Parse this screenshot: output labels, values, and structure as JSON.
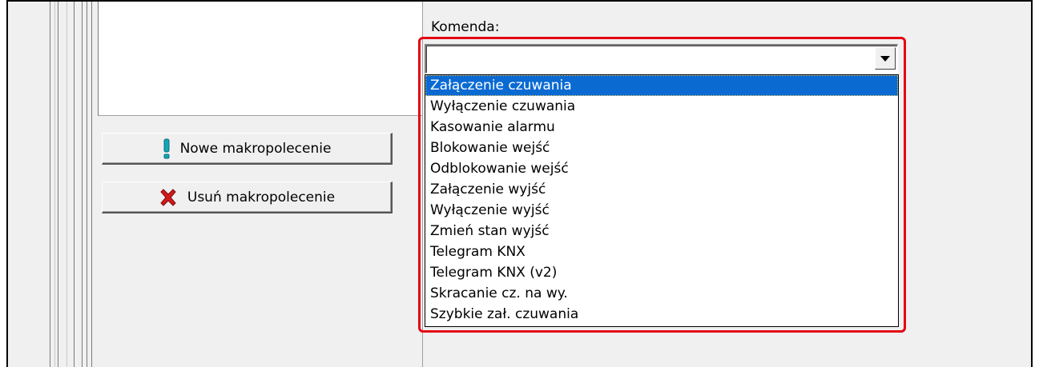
{
  "buttons": {
    "new_macro_label": "Nowe makropolecenie",
    "delete_macro_label": "Usuń makropolecenie"
  },
  "command": {
    "label": "Komenda:",
    "value": "",
    "options": [
      "Załączenie czuwania",
      "Wyłączenie czuwania",
      "Kasowanie alarmu",
      "Blokowanie wejść",
      "Odblokowanie wejść",
      "Załączenie wyjść",
      "Wyłączenie wyjść",
      "Zmień stan wyjść",
      "Telegram KNX",
      "Telegram KNX (v2)",
      "Skracanie cz. na wy.",
      "Szybkie zał. czuwania"
    ],
    "selected_index": 0
  },
  "colors": {
    "highlight_border": "#e30613",
    "selection": "#0a6ad2"
  },
  "icons": {
    "new_macro": "exclamation-icon",
    "delete_macro": "red-x-icon"
  }
}
